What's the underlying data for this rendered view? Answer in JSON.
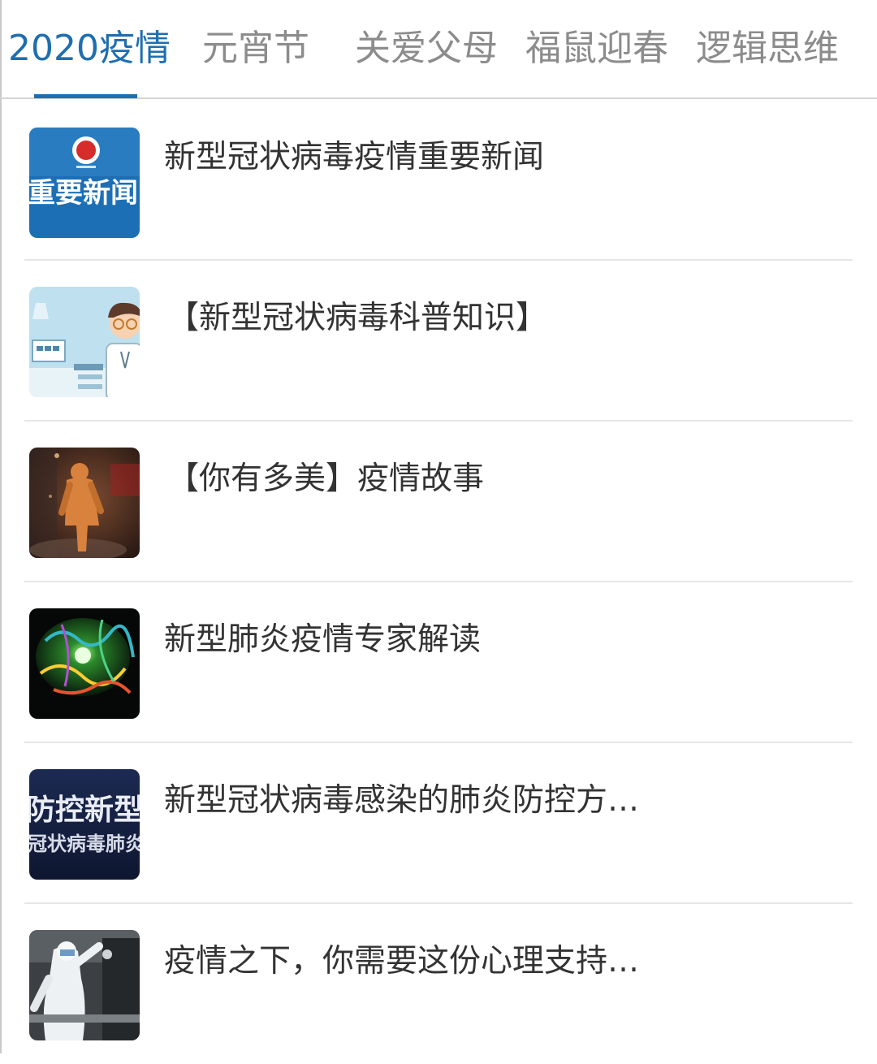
{
  "colors": {
    "accent": "#1f6eb0",
    "tab_inactive": "#8c8c8c",
    "title_text": "#333333",
    "divider": "#e6e6e6"
  },
  "tabs": [
    {
      "label": "2020疫情",
      "active": true
    },
    {
      "label": "元宵节",
      "active": false
    },
    {
      "label": "关爱父母",
      "active": false
    },
    {
      "label": "福鼠迎春",
      "active": false
    },
    {
      "label": "逻辑思维",
      "active": false
    }
  ],
  "articles": [
    {
      "title": "新型冠状病毒疫情重要新闻",
      "thumb_icon": "news-banner-icon",
      "thumb_text": "重要新闻"
    },
    {
      "title": "【新型冠状病毒科普知识】",
      "thumb_icon": "doctor-illustration-icon"
    },
    {
      "title": "【你有多美】疫情故事",
      "thumb_icon": "protective-suit-worker-photo"
    },
    {
      "title": "新型肺炎疫情专家解读",
      "thumb_icon": "virus-protein-model-image"
    },
    {
      "title": "新型冠状病毒感染的肺炎防控方…",
      "thumb_icon": "prevention-guide-cover",
      "thumb_text_1": "防控新型",
      "thumb_text_2": "冠状病毒肺炎"
    },
    {
      "title": "疫情之下，你需要这份心理支持…",
      "thumb_icon": "medical-worker-photo"
    }
  ]
}
